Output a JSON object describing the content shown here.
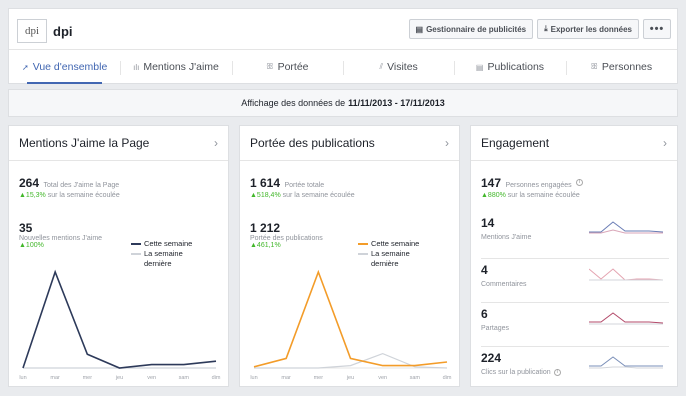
{
  "brand": {
    "logo_text": "dpi",
    "name": "dpi"
  },
  "actions": {
    "ads_manager": "Gestionnaire de publicités",
    "export": "Exporter les données",
    "more": "•••"
  },
  "tabs": [
    {
      "label": "Vue d'ensemble",
      "icon": "overview-icon",
      "active": true
    },
    {
      "label": "Mentions J'aime",
      "icon": "likes-icon"
    },
    {
      "label": "Portée",
      "icon": "reach-icon"
    },
    {
      "label": "Visites",
      "icon": "visits-icon"
    },
    {
      "label": "Publications",
      "icon": "posts-icon"
    },
    {
      "label": "Personnes",
      "icon": "people-icon"
    }
  ],
  "daterange": {
    "prefix": "Affichage des données de",
    "range": "11/11/2013 - 17/11/2013"
  },
  "likes_card": {
    "title": "Mentions J'aime la Page",
    "total_value": "264",
    "total_label": "Total des J'aime la Page",
    "total_delta": "▲15,3%",
    "total_delta_suffix": "sur la semaine écoulée",
    "new_value": "35",
    "new_label": "Nouvelles mentions J'aime",
    "new_delta": "▲100%",
    "legend_this": "Cette semaine",
    "legend_last": "La semaine dernière"
  },
  "reach_card": {
    "title": "Portée des publications",
    "total_value": "1 614",
    "total_label": "Portée totale",
    "total_delta": "▲518,4%",
    "total_delta_suffix": "sur la semaine écoulée",
    "pub_value": "1 212",
    "pub_label": "Portée des publications",
    "pub_delta": "▲461,1%",
    "legend_this": "Cette semaine",
    "legend_last": "La semaine dernière"
  },
  "engagement_card": {
    "title": "Engagement",
    "total_value": "147",
    "total_label": "Personnes engagées",
    "total_delta": "▲880%",
    "total_delta_suffix": "sur la semaine écoulée",
    "rows": [
      {
        "value": "14",
        "label": "Mentions J'aime"
      },
      {
        "value": "4",
        "label": "Commentaires"
      },
      {
        "value": "6",
        "label": "Partages"
      },
      {
        "value": "224",
        "label": "Clics sur la publication"
      }
    ]
  },
  "day_labels": [
    "lun",
    "mar",
    "mer",
    "jeu",
    "ven",
    "sam",
    "dim"
  ],
  "colors": {
    "accent": "#4267b2",
    "likes_line": "#2d3a5a",
    "reach_line": "#f39c29",
    "positive": "#42b72a",
    "last_week": "#cfd3d9"
  },
  "chart_data": [
    {
      "type": "line",
      "title": "Mentions J'aime la Page",
      "x": [
        "lun",
        "mar",
        "mer",
        "jeu",
        "ven",
        "sam",
        "dim"
      ],
      "series": [
        {
          "name": "Cette semaine",
          "values": [
            0,
            28,
            4,
            0,
            1,
            1,
            2
          ]
        },
        {
          "name": "La semaine dernière",
          "values": [
            0,
            0,
            0,
            0,
            0,
            0,
            0
          ]
        }
      ]
    },
    {
      "type": "line",
      "title": "Portée des publications",
      "x": [
        "lun",
        "mar",
        "mer",
        "jeu",
        "ven",
        "sam",
        "dim"
      ],
      "series": [
        {
          "name": "Cette semaine",
          "values": [
            5,
            40,
            400,
            40,
            10,
            10,
            25
          ]
        },
        {
          "name": "La semaine dernière",
          "values": [
            0,
            0,
            0,
            10,
            60,
            5,
            0
          ]
        }
      ]
    }
  ]
}
